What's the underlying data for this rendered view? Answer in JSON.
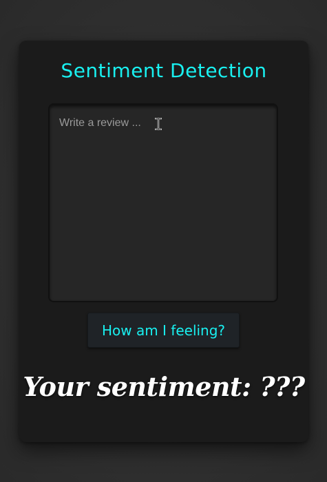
{
  "app": {
    "title": "Sentiment Detection"
  },
  "review": {
    "placeholder": "Write a review ...",
    "value": ""
  },
  "button": {
    "label": "How am I feeling?"
  },
  "result": {
    "text": "Your sentiment: ???"
  },
  "icons": {
    "cursor": "text-cursor-icon"
  },
  "colors": {
    "accent": "#19f0f0",
    "card_background": "#1b1b1b",
    "page_background": "#333333",
    "result_text": "#ffffff"
  }
}
